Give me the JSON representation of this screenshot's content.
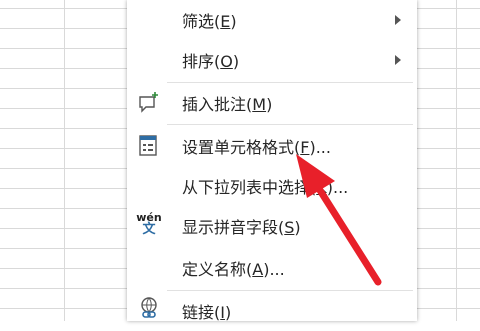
{
  "menu": {
    "items": [
      {
        "label": "筛选(E)",
        "prefix": "筛选(",
        "key": "E",
        "suffix": ")",
        "submenu": true
      },
      {
        "label": "排序(O)",
        "prefix": "排序(",
        "key": "O",
        "suffix": ")",
        "submenu": true
      },
      {
        "label": "插入批注(M)",
        "prefix": "插入批注(",
        "key": "M",
        "suffix": ")",
        "icon": "comment-add-icon"
      },
      {
        "label": "设置单元格格式(F)...",
        "prefix": "设置单元格格式(",
        "key": "F",
        "suffix": ")...",
        "icon": "format-cells-icon"
      },
      {
        "label": "从下拉列表中选择(K)...",
        "prefix": "从下拉列表中选择(",
        "key": "K",
        "suffix": ")..."
      },
      {
        "label": "显示拼音字段(S)",
        "prefix": "显示拼音字段(",
        "key": "S",
        "suffix": ")",
        "icon": "phonetic-icon",
        "icon_text_top": "wén",
        "icon_text_bottom": "文"
      },
      {
        "label": "定义名称(A)...",
        "prefix": "定义名称(",
        "key": "A",
        "suffix": ")..."
      },
      {
        "label": "链接(I)",
        "prefix": "链接(",
        "key": "I",
        "suffix": ")",
        "icon": "link-icon"
      }
    ]
  },
  "colors": {
    "annotation_arrow": "#e8202a",
    "icon_accent": "#2e6da4"
  }
}
